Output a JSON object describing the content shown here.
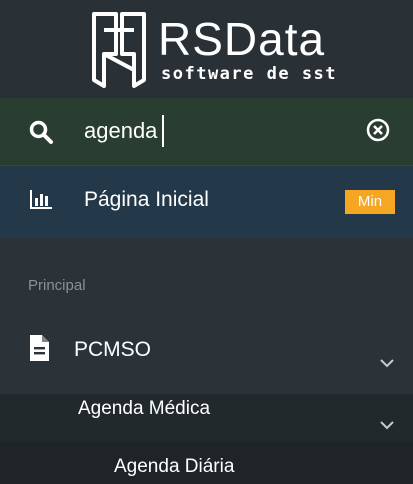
{
  "brand": {
    "name": "RSData",
    "tagline": "software de sst"
  },
  "search": {
    "value": "agenda",
    "icon": "search-icon",
    "clear_icon": "clear-circle-x-icon"
  },
  "nav": {
    "home": {
      "label": "Página Inicial",
      "icon": "bar-chart-icon",
      "badge": "Min"
    },
    "section_header": "Principal",
    "items": [
      {
        "label": "PCMSO",
        "icon": "document-icon",
        "children": [
          {
            "label": "Agenda Médica",
            "children": [
              {
                "label": "Agenda Diária"
              }
            ]
          }
        ]
      }
    ]
  },
  "colors": {
    "background": "#2b3338",
    "search_bg": "#2a3d31",
    "active_bg": "#23394a",
    "badge": "#f5a623",
    "section_header_text": "#8a9095"
  }
}
